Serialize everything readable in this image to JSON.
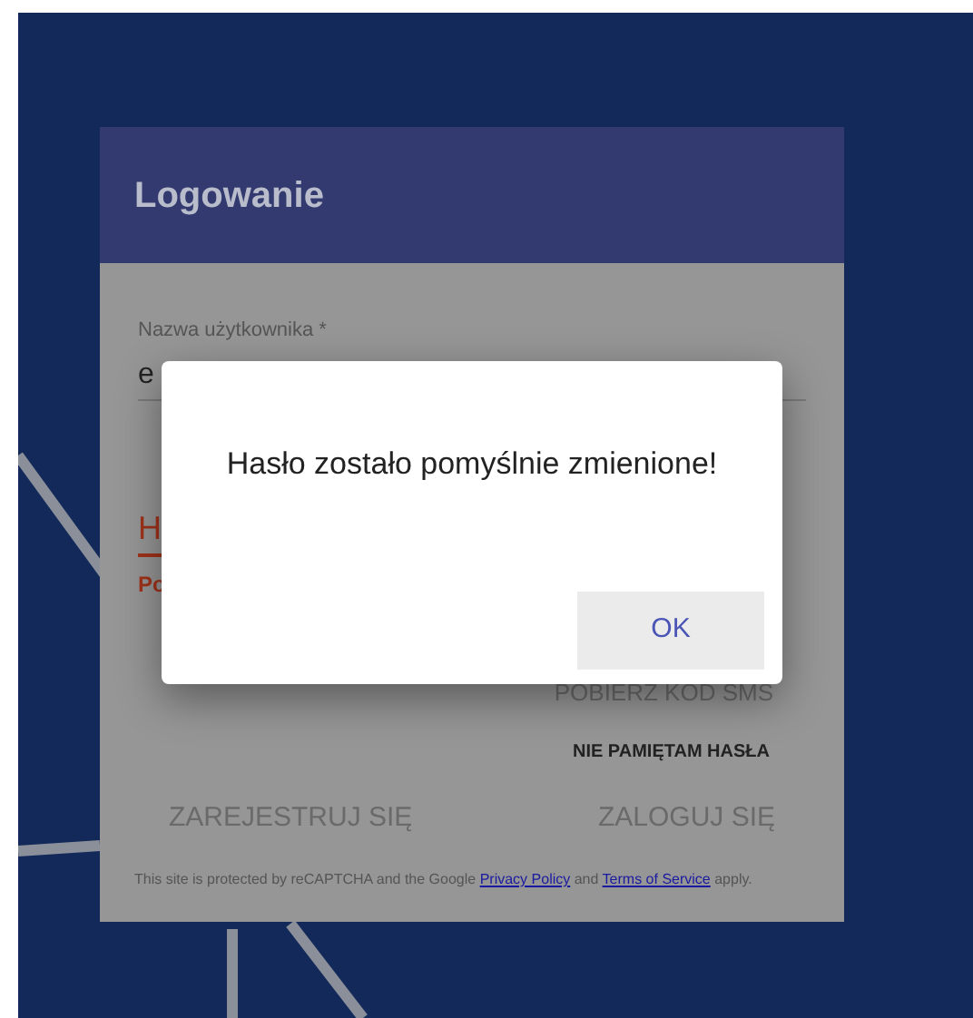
{
  "login_card": {
    "title": "Logowanie",
    "username": {
      "label": "Nazwa użytkownika *",
      "value": "e"
    },
    "password": {
      "label": "H",
      "error": "Po",
      "invalid": true
    },
    "sms_button": "POBIERZ KOD SMS",
    "forgot_link": "NIE PAMIĘTAM HASŁA",
    "register_button": "ZAREJESTRUJ SIĘ",
    "login_button": "ZALOGUJ SIĘ",
    "recaptcha": {
      "before": "This site is protected by reCAPTCHA and the Google",
      "privacy": "Privacy Policy",
      "middle": "and",
      "terms": "Terms of Service",
      "after": "apply."
    }
  },
  "dialog": {
    "message": "Hasło zostało pomyślnie zmienione!",
    "buttons": [
      "OK"
    ]
  }
}
